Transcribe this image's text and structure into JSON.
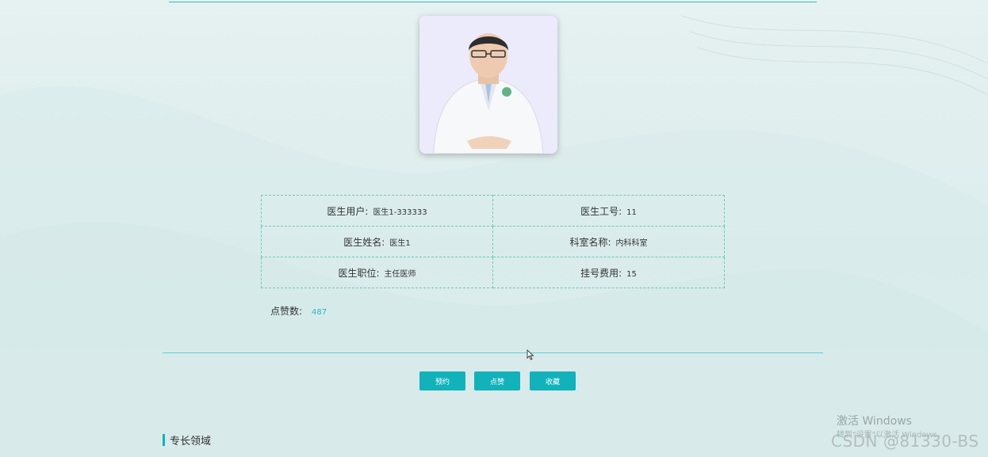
{
  "doctor_info": {
    "rows": [
      [
        {
          "label": "医生用户:",
          "value": "医生1-333333"
        },
        {
          "label": "医生工号:",
          "value": "11"
        }
      ],
      [
        {
          "label": "医生姓名:",
          "value": "医生1"
        },
        {
          "label": "科室名称:",
          "value": "内科科室"
        }
      ],
      [
        {
          "label": "医生职位:",
          "value": "主任医师"
        },
        {
          "label": "挂号费用:",
          "value": "15"
        }
      ]
    ]
  },
  "likes": {
    "label": "点赞数:",
    "value": "487"
  },
  "actions": {
    "book": "预约",
    "like": "点赞",
    "favorite": "收藏"
  },
  "section": {
    "specialty": "专长领域"
  },
  "watermarks": {
    "activate_title": "激活 Windows",
    "activate_hint": "转到\"设置\"以激活 Windows。",
    "csdn": "CSDN @81330-BS"
  },
  "colors": {
    "accent": "#12b2bb",
    "border": "#6fc9b8",
    "line": "#5ecfd6"
  },
  "icons": {
    "cursor": "mouse-cursor-icon"
  }
}
